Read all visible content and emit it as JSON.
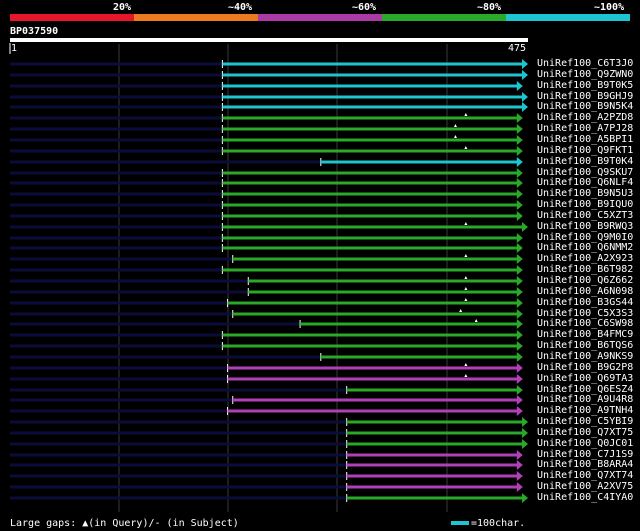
{
  "legend": {
    "pct_labels": [
      "20%",
      "~40%",
      "~60%",
      "~80%",
      "~100%"
    ],
    "colors": [
      "#e8162a",
      "#ec7a1e",
      "#a93aa6",
      "#2aa82a",
      "#1ec4d0"
    ]
  },
  "query": {
    "id": "BP037590",
    "start": "1",
    "end": "475"
  },
  "colors": {
    "green": "#2aa82a",
    "magenta": "#b040b8",
    "cyan": "#1ec4d0",
    "navy": "#0c0c3a",
    "grid": "#3a3a3a",
    "query_bar": "#ffffff"
  },
  "footer": {
    "gaps_text": "Large gaps: ▲(in Query)/- (in Subject)",
    "scale_text": "=100char."
  },
  "hits": [
    {
      "id": "UniRef100_C6T3J0",
      "c": "cyan",
      "s": 0.41,
      "e": 1.0,
      "g": []
    },
    {
      "id": "UniRef100_Q9ZWN0",
      "c": "cyan",
      "s": 0.41,
      "e": 1.0,
      "g": []
    },
    {
      "id": "UniRef100_B9T0K5",
      "c": "cyan",
      "s": 0.41,
      "e": 0.99,
      "g": []
    },
    {
      "id": "UniRef100_B9GHJ9",
      "c": "cyan",
      "s": 0.41,
      "e": 1.0,
      "g": []
    },
    {
      "id": "UniRef100_B9N5K4",
      "c": "cyan",
      "s": 0.41,
      "e": 1.0,
      "g": []
    },
    {
      "id": "UniRef100_A2PZD8",
      "c": "green",
      "s": 0.41,
      "e": 0.99,
      "g": [
        0.88
      ]
    },
    {
      "id": "UniRef100_A7PJ28",
      "c": "green",
      "s": 0.41,
      "e": 0.99,
      "g": [
        0.86
      ]
    },
    {
      "id": "UniRef100_A5BPI1",
      "c": "green",
      "s": 0.41,
      "e": 0.99,
      "g": [
        0.86
      ]
    },
    {
      "id": "UniRef100_Q9FKT1",
      "c": "green",
      "s": 0.41,
      "e": 0.99,
      "g": [
        0.88
      ]
    },
    {
      "id": "UniRef100_B9T0K4",
      "c": "cyan",
      "s": 0.6,
      "e": 0.99,
      "g": []
    },
    {
      "id": "UniRef100_Q9SKU7",
      "c": "green",
      "s": 0.41,
      "e": 0.99,
      "g": []
    },
    {
      "id": "UniRef100_Q6NLF4",
      "c": "green",
      "s": 0.41,
      "e": 0.99,
      "g": []
    },
    {
      "id": "UniRef100_B9N5U3",
      "c": "green",
      "s": 0.41,
      "e": 0.99,
      "g": []
    },
    {
      "id": "UniRef100_B9IQU0",
      "c": "green",
      "s": 0.41,
      "e": 0.99,
      "g": []
    },
    {
      "id": "UniRef100_C5XZT3",
      "c": "green",
      "s": 0.41,
      "e": 0.99,
      "g": []
    },
    {
      "id": "UniRef100_B9RWQ3",
      "c": "green",
      "s": 0.41,
      "e": 1.0,
      "g": [
        0.88
      ]
    },
    {
      "id": "UniRef100_Q9M0I0",
      "c": "green",
      "s": 0.41,
      "e": 0.99,
      "g": []
    },
    {
      "id": "UniRef100_Q6NMM2",
      "c": "green",
      "s": 0.41,
      "e": 0.99,
      "g": []
    },
    {
      "id": "UniRef100_A2X923",
      "c": "green",
      "s": 0.43,
      "e": 0.99,
      "g": [
        0.88
      ]
    },
    {
      "id": "UniRef100_B6T982",
      "c": "green",
      "s": 0.41,
      "e": 0.99,
      "g": []
    },
    {
      "id": "UniRef100_Q6Z662",
      "c": "green",
      "s": 0.46,
      "e": 0.99,
      "g": [
        0.88
      ]
    },
    {
      "id": "UniRef100_A6N098",
      "c": "green",
      "s": 0.46,
      "e": 0.99,
      "g": [
        0.88
      ]
    },
    {
      "id": "UniRef100_B3GS44",
      "c": "green",
      "s": 0.42,
      "e": 0.99,
      "g": [
        0.88
      ]
    },
    {
      "id": "UniRef100_C5X3S3",
      "c": "green",
      "s": 0.43,
      "e": 0.99,
      "g": [
        0.87
      ]
    },
    {
      "id": "UniRef100_C6SW98",
      "c": "green",
      "s": 0.56,
      "e": 0.99,
      "g": [
        0.9
      ]
    },
    {
      "id": "UniRef100_B4FMC9",
      "c": "green",
      "s": 0.41,
      "e": 0.99,
      "g": []
    },
    {
      "id": "UniRef100_B6TQS6",
      "c": "green",
      "s": 0.41,
      "e": 0.99,
      "g": []
    },
    {
      "id": "UniRef100_A9NKS9",
      "c": "green",
      "s": 0.6,
      "e": 0.99,
      "g": []
    },
    {
      "id": "UniRef100_B9G2P8",
      "c": "magenta",
      "s": 0.42,
      "e": 0.99,
      "g": [
        0.88
      ]
    },
    {
      "id": "UniRef100_Q69TA3",
      "c": "magenta",
      "s": 0.42,
      "e": 0.99,
      "g": [
        0.88
      ]
    },
    {
      "id": "UniRef100_Q6ESZ4",
      "c": "green",
      "s": 0.65,
      "e": 0.99,
      "g": []
    },
    {
      "id": "UniRef100_A9U4R8",
      "c": "magenta",
      "s": 0.43,
      "e": 0.99,
      "g": []
    },
    {
      "id": "UniRef100_A9TNH4",
      "c": "magenta",
      "s": 0.42,
      "e": 0.99,
      "g": []
    },
    {
      "id": "UniRef100_C5YBI9",
      "c": "green",
      "s": 0.65,
      "e": 1.0,
      "g": []
    },
    {
      "id": "UniRef100_Q7XT75",
      "c": "green",
      "s": 0.65,
      "e": 1.0,
      "g": []
    },
    {
      "id": "UniRef100_Q0JC01",
      "c": "green",
      "s": 0.65,
      "e": 1.0,
      "g": []
    },
    {
      "id": "UniRef100_C7J1S9",
      "c": "magenta",
      "s": 0.65,
      "e": 0.99,
      "g": []
    },
    {
      "id": "UniRef100_B8ARA4",
      "c": "magenta",
      "s": 0.65,
      "e": 0.99,
      "g": []
    },
    {
      "id": "UniRef100_Q7XT74",
      "c": "magenta",
      "s": 0.65,
      "e": 0.99,
      "g": []
    },
    {
      "id": "UniRef100_A2XV75",
      "c": "magenta",
      "s": 0.65,
      "e": 0.99,
      "g": []
    },
    {
      "id": "UniRef100_C4IYA0",
      "c": "green",
      "s": 0.65,
      "e": 1.0,
      "g": []
    }
  ]
}
